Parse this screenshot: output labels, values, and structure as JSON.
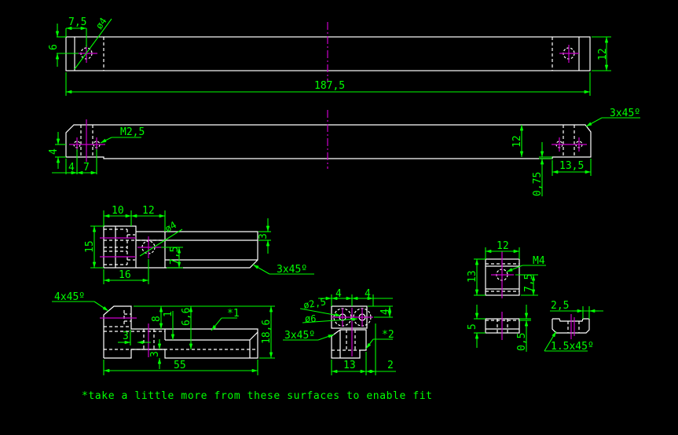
{
  "drawing": {
    "background": "#000000",
    "colors": {
      "outline": "#ffffff",
      "dimension": "#00ff00",
      "centerline": "#cc00cc"
    },
    "view1": {
      "dims": {
        "edge_offset": "7,5",
        "hole_dia": "ø4",
        "hole_height": "6",
        "height": "12",
        "length": "187,5"
      }
    },
    "view2": {
      "dims": {
        "thread": "M2,5",
        "height_left": "4",
        "pos_a": "4",
        "pos_b": "7",
        "height_right": "12",
        "chamfer": "3x45º",
        "gap": "0,75",
        "end_length": "13,5"
      }
    },
    "view3": {
      "dims": {
        "width_a": "10",
        "width_b": "12",
        "height": "15",
        "offset": "16",
        "hole_dia": "ø4",
        "top_offset": "3",
        "hole_height": "7,5",
        "chamfer": "3x45º"
      }
    },
    "view4": {
      "dims": {
        "chamfer": "4x45º",
        "d8": "8",
        "d1": "1",
        "d6_6": "6,6",
        "note_ref": "*1",
        "height": "18,6",
        "d3a": "3",
        "d3b": "3",
        "length": "55"
      }
    },
    "view5": {
      "dims": {
        "hole_small": "ø2,5",
        "hole_large": "ø6",
        "chamfer": "3x45º",
        "width_a": "4",
        "width_b": "4",
        "height": "4",
        "note_ref": "*2",
        "width": "13",
        "gap": "2"
      }
    },
    "view6": {
      "dims": {
        "width": "12",
        "height": "13",
        "thread": "M4",
        "hole_height": "7,5"
      }
    },
    "view7": {
      "dims": {
        "height": "5",
        "offset": "0,5"
      }
    },
    "view8": {
      "dims": {
        "slot": "2,5",
        "chamfer": "1.5x45º"
      }
    },
    "note": "*take a little more from these surfaces to enable fit"
  }
}
